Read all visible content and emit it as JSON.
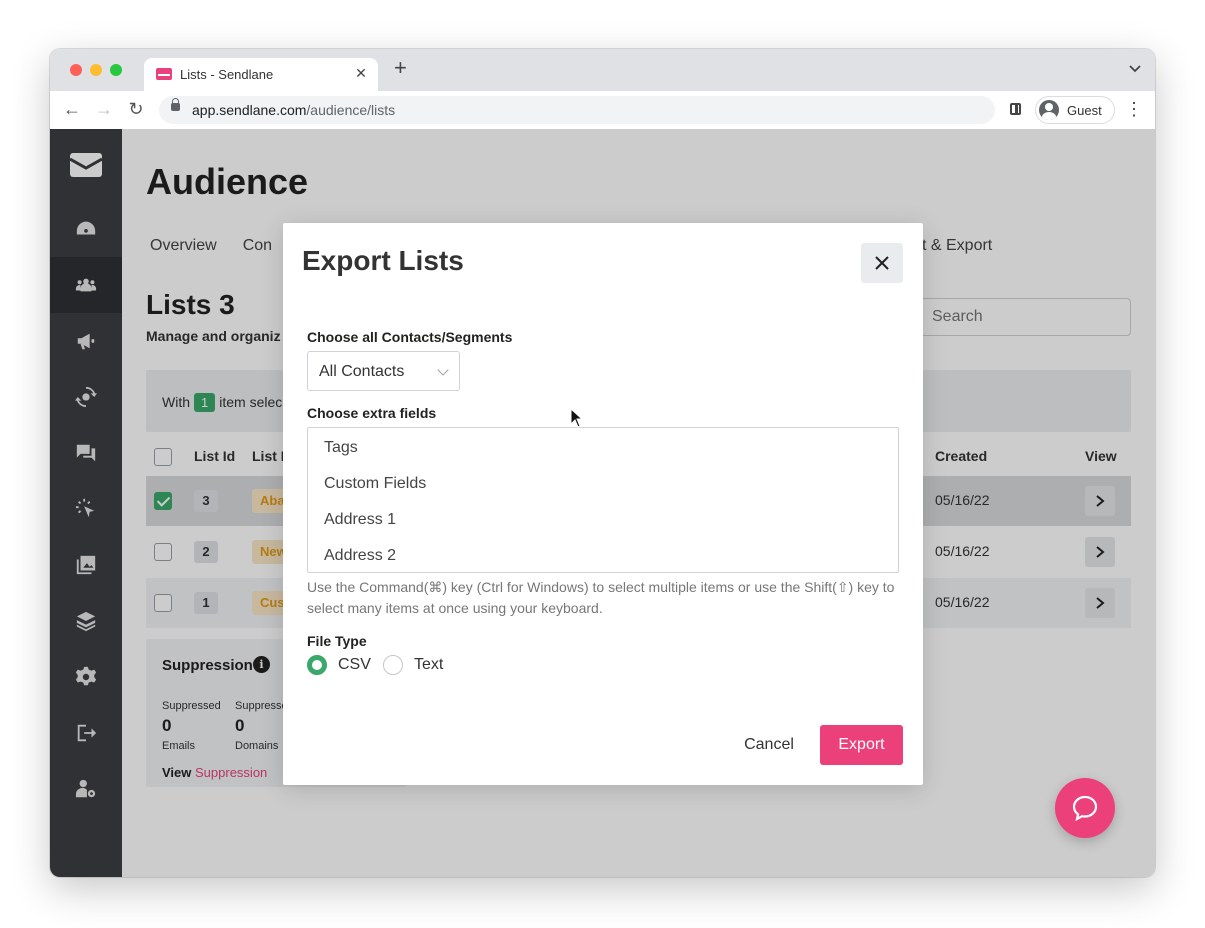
{
  "browser": {
    "tab_title": "Lists - Sendlane",
    "tab_close": "✕",
    "new_tab": "+",
    "tab_menu": "⌄",
    "url_host": "app.sendlane.com",
    "url_path": "/audience/lists",
    "profile_name": "Guest",
    "menu": "⋮",
    "back": "←",
    "forward": "→",
    "reload": "↻"
  },
  "sidebar": {
    "items": [
      {
        "icon": "logo-envelope-icon"
      },
      {
        "icon": "dashboard-gauge-icon"
      },
      {
        "icon": "audience-users-icon",
        "active": true
      },
      {
        "icon": "megaphone-icon"
      },
      {
        "icon": "automation-icon"
      },
      {
        "icon": "chat-icon"
      },
      {
        "icon": "click-tracking-icon"
      },
      {
        "icon": "gallery-icon"
      },
      {
        "icon": "integrations-layers-icon"
      },
      {
        "icon": "settings-gear-icon"
      },
      {
        "icon": "logout-icon"
      },
      {
        "icon": "user-settings-icon"
      }
    ]
  },
  "page": {
    "title": "Audience",
    "subnav": [
      "Overview",
      "Con"
    ],
    "subnav_right": "t & Export",
    "lists_title": "Lists 3",
    "lists_desc": "Manage and organiz",
    "search_placeholder": "Search",
    "bulk_prefix": "With",
    "bulk_count": "1",
    "bulk_suffix": "item selec"
  },
  "table": {
    "headers": {
      "id": "List Id",
      "name": "List I",
      "created": "Created",
      "view": "View"
    },
    "rows": [
      {
        "checked": true,
        "id": "3",
        "tag": "Aba",
        "created": "05/16/22"
      },
      {
        "checked": false,
        "id": "2",
        "tag": "New",
        "created": "05/16/22"
      },
      {
        "checked": false,
        "id": "1",
        "tag": "Cus",
        "created": "05/16/22"
      }
    ]
  },
  "suppression": {
    "title": "Suppression",
    "info": "i",
    "col1_label": "Suppressed",
    "col1_value": "0",
    "col1_unit": "Emails",
    "col2_label": "Suppresse",
    "col2_value": "0",
    "col2_unit": "Domains",
    "view_prefix": "View",
    "view_link": "Suppression"
  },
  "modal": {
    "title": "Export Lists",
    "contacts_label": "Choose all Contacts/Segments",
    "contacts_value": "All Contacts",
    "fields_label": "Choose extra fields",
    "fields_options": [
      "Tags",
      "Custom Fields",
      "Address 1",
      "Address 2"
    ],
    "help_text": "Use the Command(⌘) key (Ctrl for Windows) to select multiple items or use the Shift(⇧) key to select many items at once using your keyboard.",
    "file_type_label": "File Type",
    "file_types": [
      {
        "label": "CSV",
        "selected": true
      },
      {
        "label": "Text",
        "selected": false
      }
    ],
    "cancel_label": "Cancel",
    "export_label": "Export"
  },
  "colors": {
    "brand_pink": "#ec407a",
    "success_green": "#3aa86b",
    "sidebar_bg": "#3b3e43"
  }
}
